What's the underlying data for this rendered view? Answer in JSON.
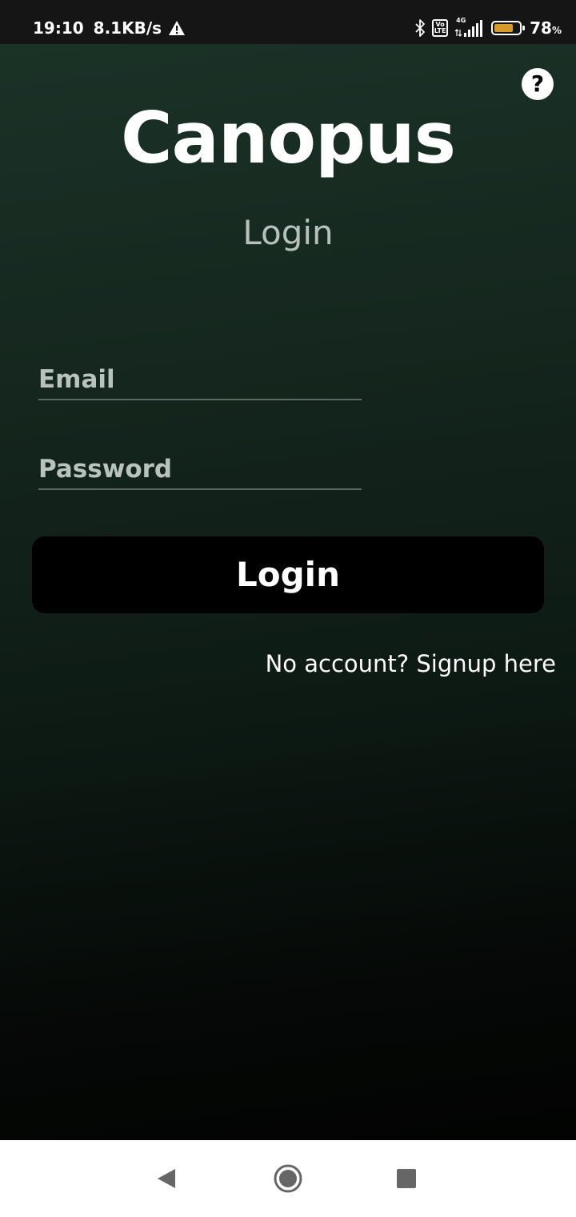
{
  "status_bar": {
    "time": "19:10",
    "network_speed": "8.1KB/s",
    "network_type": "4G",
    "volte_top": "Vo",
    "volte_bottom": "LTE",
    "battery_level": 78,
    "battery_number": "78",
    "battery_unit": "%",
    "battery_color": "#d69b2c",
    "icons": [
      "warning-icon",
      "bluetooth-icon",
      "volte-icon",
      "signal-icon",
      "battery-icon"
    ]
  },
  "header": {
    "app_title": "Canopus",
    "page_title": "Login",
    "help_label": "?"
  },
  "form": {
    "email_placeholder": "Email",
    "email_value": "",
    "password_placeholder": "Password",
    "password_value": "",
    "login_label": "Login",
    "signup_label": "No account? Signup here"
  },
  "nav_bar": {
    "icons": [
      "back-icon",
      "home-icon",
      "recents-icon"
    ]
  },
  "colors": {
    "background_top": "#1b3227",
    "background_bottom": "#020302",
    "button": "#000000",
    "text": "#ffffff"
  }
}
